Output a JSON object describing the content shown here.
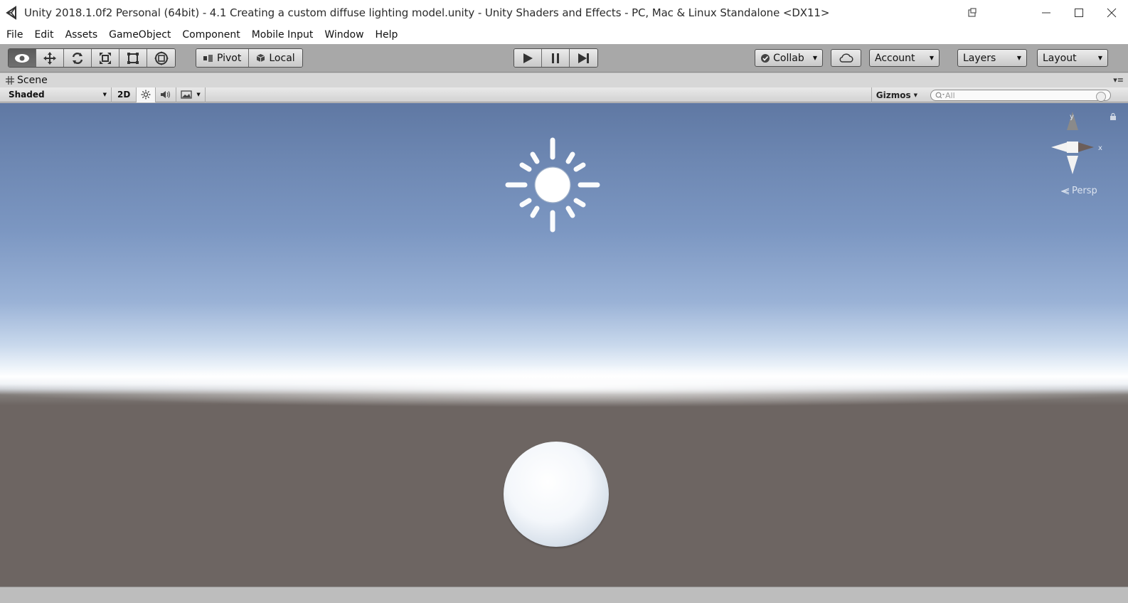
{
  "window": {
    "title": "Unity 2018.1.0f2 Personal (64bit) - 4.1 Creating a custom diffuse lighting model.unity - Unity Shaders and Effects - PC, Mac & Linux Standalone <DX11>"
  },
  "menu": {
    "items": [
      "File",
      "Edit",
      "Assets",
      "GameObject",
      "Component",
      "Mobile Input",
      "Window",
      "Help"
    ]
  },
  "toolbar": {
    "pivot_label": "Pivot",
    "local_label": "Local",
    "collab_label": "Collab",
    "account_label": "Account",
    "layers_label": "Layers",
    "layout_label": "Layout"
  },
  "scene": {
    "tab_label": "Scene",
    "shading_mode": "Shaded",
    "toggle_2d": "2D",
    "gizmos_label": "Gizmos",
    "search_placeholder": "All",
    "projection_label": "Persp",
    "axis_y": "y",
    "axis_x": "x"
  },
  "colors": {
    "sky_top": "#5f78a3",
    "horizon": "#ffffff",
    "ground": "#6d6562",
    "toolbar_bg": "#a8a8a8"
  }
}
